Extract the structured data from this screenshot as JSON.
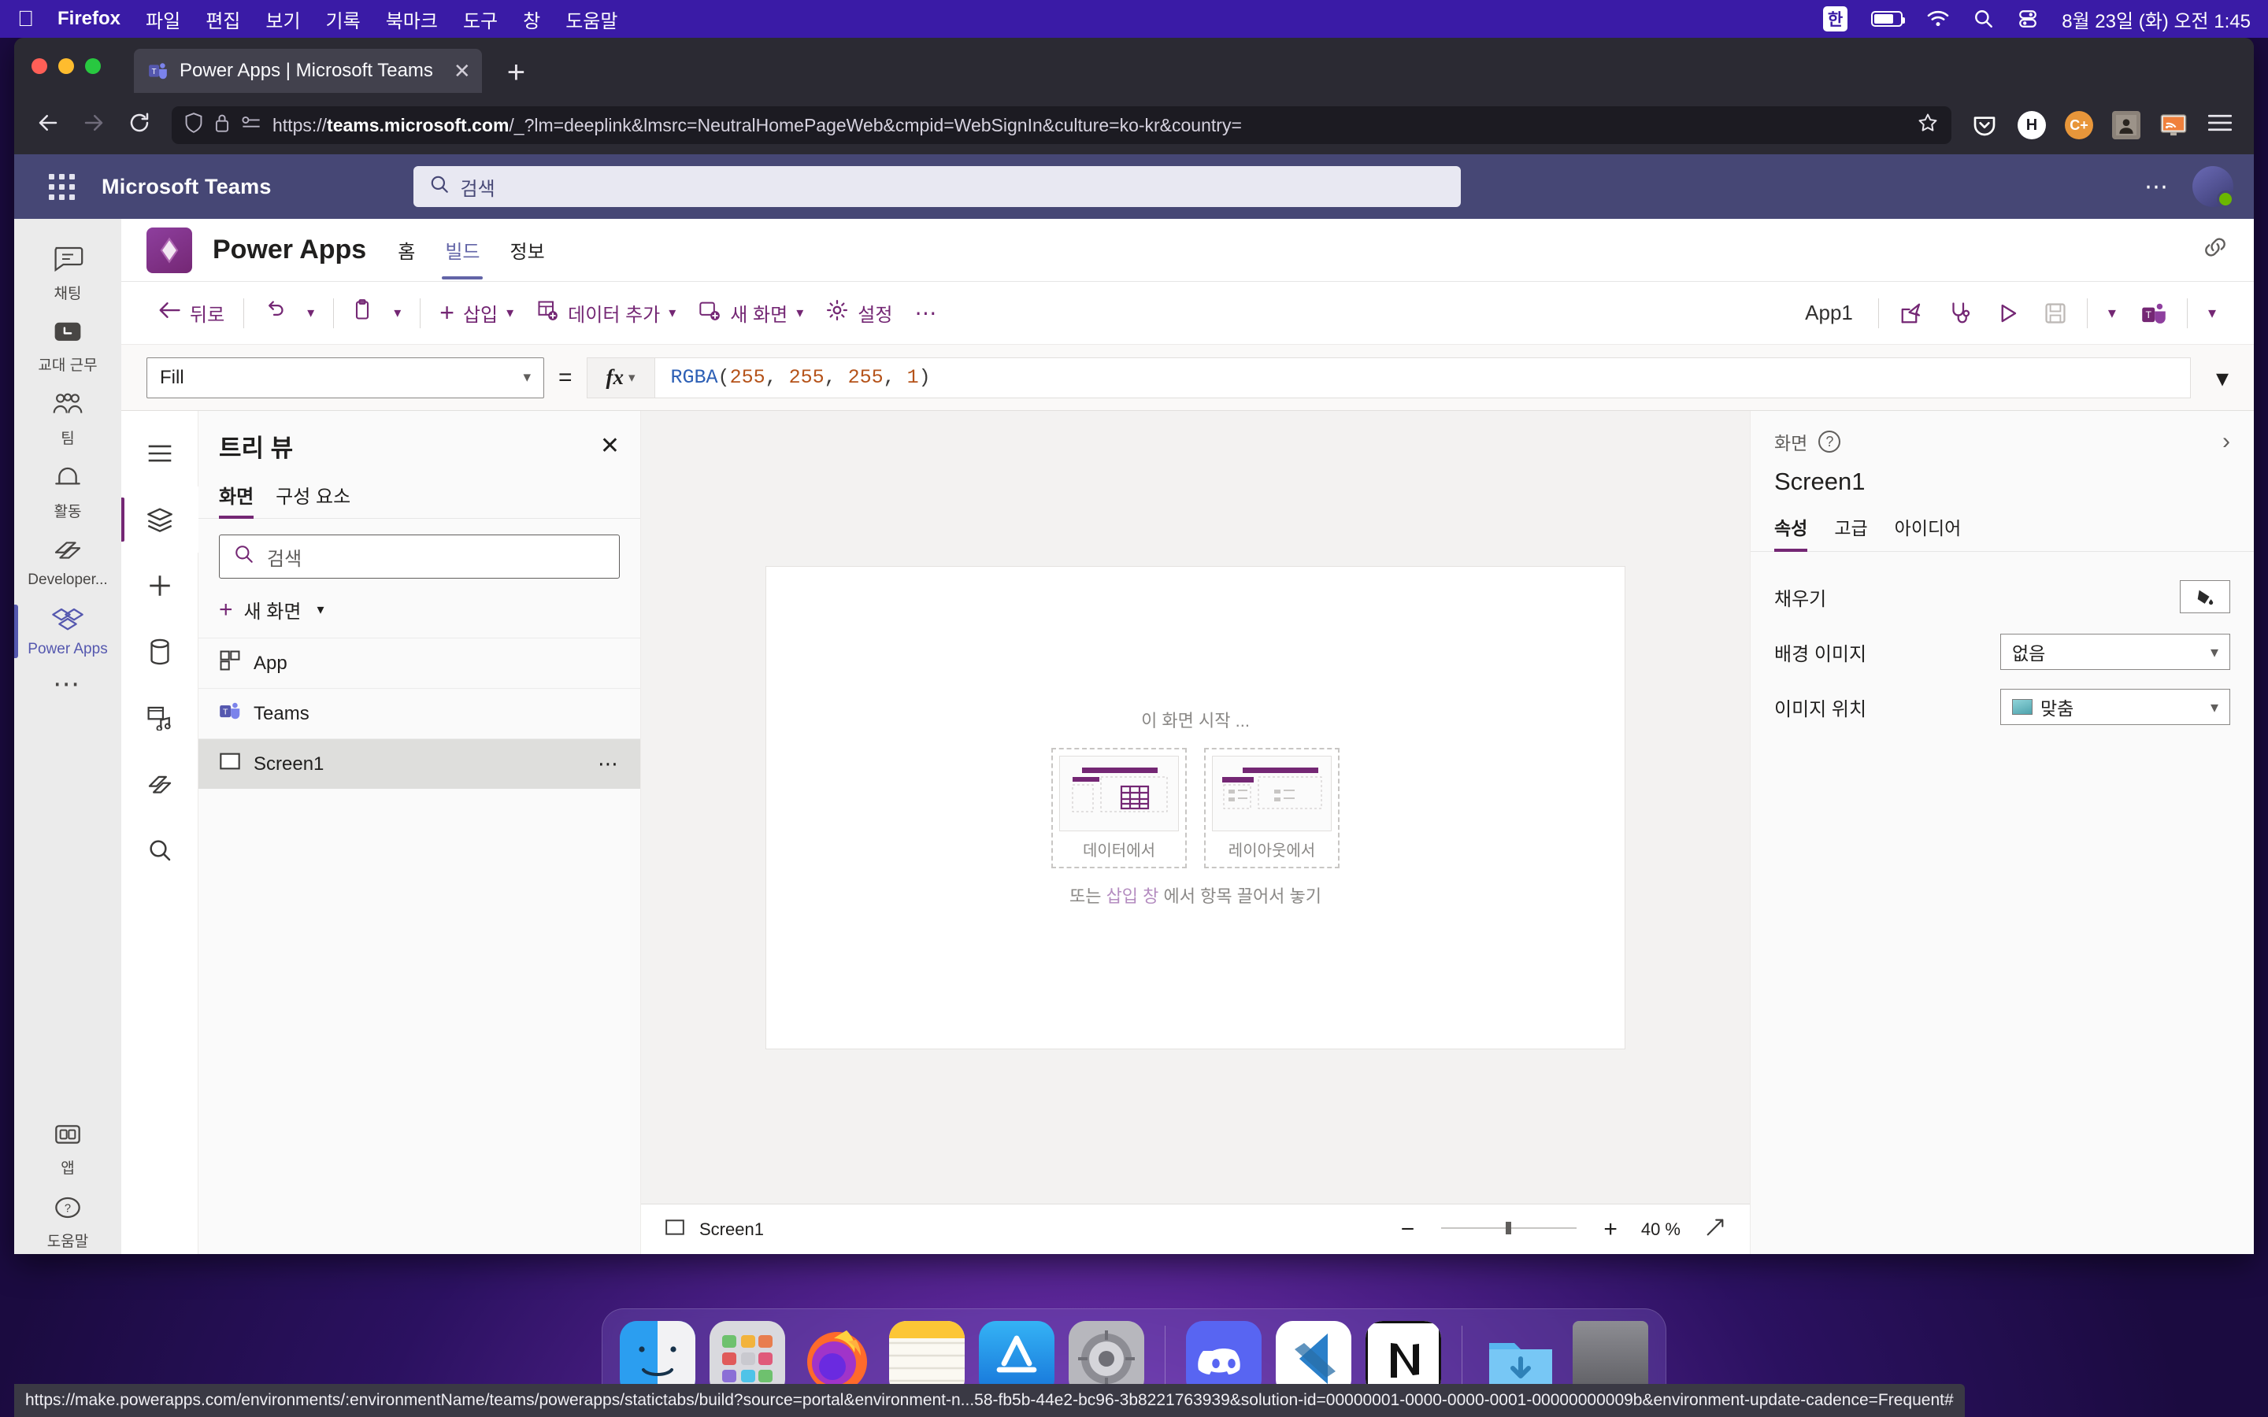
{
  "macos_menubar": {
    "apple_icon": "apple-icon",
    "app_name": "Firefox",
    "menus": [
      "파일",
      "편집",
      "보기",
      "기록",
      "북마크",
      "도구",
      "창",
      "도움말"
    ],
    "input_source": "한",
    "status_icons": [
      "battery-icon",
      "wifi-icon",
      "search-icon",
      "control-center-icon"
    ],
    "datetime": "8월 23일 (화) 오전 1:45"
  },
  "browser": {
    "tab": {
      "title": "Power Apps | Microsoft Teams",
      "favicon": "teams-icon",
      "close_icon": "close-icon"
    },
    "new_tab_icon": "plus-icon",
    "back_icon": "back-arrow-icon",
    "forward_icon": "forward-arrow-icon",
    "reload_icon": "reload-icon",
    "shield_icon": "shield-icon",
    "lock_icon": "lock-icon",
    "permissions_icon": "permissions-icon",
    "url": "https://teams.microsoft.com/_?lm=deeplink&lmsrc=NeutralHomePageWeb&cmpid=WebSignIn&culture=ko-kr&country=",
    "url_host": "teams.microsoft.com",
    "url_scheme": "https://",
    "url_rest": "/_?lm=deeplink&lmsrc=NeutralHomePageWeb&cmpid=WebSignIn&culture=ko-kr&country=",
    "bookmark_icon": "star-icon",
    "extensions": [
      "pocket-icon",
      "h-extension-icon",
      "c-plus-extension-icon",
      "dark-extension-icon",
      "rss-extension-icon"
    ],
    "menu_icon": "hamburger-menu-icon"
  },
  "teams": {
    "waffle_icon": "app-launcher-icon",
    "title": "Microsoft Teams",
    "search": {
      "placeholder": "검색",
      "icon": "search-icon"
    },
    "more_icon": "more-icon",
    "avatar": "user-avatar",
    "rail": [
      {
        "label": "채팅",
        "icon": "chat-icon",
        "active": false
      },
      {
        "label": "교대 근무",
        "icon": "shifts-icon",
        "active": false
      },
      {
        "label": "팀",
        "icon": "teams-people-icon",
        "active": false
      },
      {
        "label": "활동",
        "icon": "bell-icon",
        "active": false
      },
      {
        "label": "Developer...",
        "icon": "developer-portal-icon",
        "active": false
      },
      {
        "label": "Power Apps",
        "icon": "power-apps-icon",
        "active": true
      },
      {
        "label": "",
        "icon": "more-dots-icon",
        "active": false
      }
    ],
    "rail_bottom": [
      {
        "label": "앱",
        "icon": "apps-grid-icon"
      },
      {
        "label": "도움말",
        "icon": "help-icon"
      }
    ]
  },
  "powerapps": {
    "logo_icon": "power-apps-logo",
    "name": "Power Apps",
    "tabs": [
      {
        "label": "홈",
        "active": false
      },
      {
        "label": "빌드",
        "active": true
      },
      {
        "label": "정보",
        "active": false
      }
    ],
    "header_right_icon": "link-icon",
    "commandbar": {
      "back": {
        "label": "뒤로",
        "icon": "back-arrow-icon"
      },
      "undo_icon": "undo-icon",
      "undo_chevron": "chevron-down-icon",
      "paste_icon": "clipboard-icon",
      "paste_chevron": "chevron-down-icon",
      "insert": {
        "label": "삽입",
        "icon": "plus-icon",
        "chevron": "chevron-down-icon"
      },
      "add_data": {
        "label": "데이터 추가",
        "icon": "add-data-icon",
        "chevron": "chevron-down-icon"
      },
      "new_screen": {
        "label": "새 화면",
        "icon": "new-screen-icon",
        "chevron": "chevron-down-icon"
      },
      "settings": {
        "label": "설정",
        "icon": "gear-icon"
      },
      "overflow_icon": "more-icon",
      "app_name": "App1",
      "share_icon": "share-icon",
      "checker_icon": "app-checker-icon",
      "preview_icon": "play-icon",
      "save_icon": "save-icon",
      "save_chevron": "chevron-down-icon",
      "teams_icon": "teams-icon",
      "teams_chevron": "chevron-down-icon"
    },
    "formula_bar": {
      "property": "Fill",
      "property_chevron": "chevron-down-icon",
      "equals": "=",
      "fx_icon": "fx-icon",
      "fx_chevron": "chevron-down-icon",
      "formula_fn": "RGBA",
      "formula_open": "(",
      "formula_args": [
        "255",
        "255",
        "255",
        "1"
      ],
      "formula_close": ")",
      "formula_full": "RGBA(255, 255, 255, 1)",
      "collapse_icon": "chevron-down-icon"
    },
    "mini_rail": [
      {
        "icon": "hamburger-menu-icon",
        "active": false
      },
      {
        "icon": "tree-view-layers-icon",
        "active": true
      },
      {
        "icon": "insert-plus-icon",
        "active": false
      },
      {
        "icon": "data-cylinder-icon",
        "active": false
      },
      {
        "icon": "media-icon",
        "active": false
      },
      {
        "icon": "power-automate-icon",
        "active": false
      },
      {
        "icon": "search-icon",
        "active": false
      }
    ],
    "treeview": {
      "title": "트리 뷰",
      "close_icon": "close-icon",
      "tabs": [
        {
          "label": "화면",
          "active": true
        },
        {
          "label": "구성 요소",
          "active": false
        }
      ],
      "search_placeholder": "검색",
      "search_icon": "search-icon",
      "new_screen": {
        "label": "새 화면",
        "plus": "+",
        "chevron": "chevron-down-icon"
      },
      "items": [
        {
          "label": "App",
          "icon": "app-node-icon",
          "selected": false,
          "has_menu": false
        },
        {
          "label": "Teams",
          "icon": "teams-icon",
          "selected": false,
          "has_menu": false
        },
        {
          "label": "Screen1",
          "icon": "screen-rect-icon",
          "selected": true,
          "has_menu": true,
          "menu_icon": "more-icon"
        }
      ]
    },
    "canvas": {
      "starter_hint": "이 화면 시작 ...",
      "options": [
        {
          "label": "데이터에서",
          "icon": "from-data-icon"
        },
        {
          "label": "레이아웃에서",
          "icon": "from-layout-icon"
        }
      ],
      "drag_hint_prefix": "또는 ",
      "drag_hint_link": "삽입 창",
      "drag_hint_suffix": " 에서 항목 끌어서 놓기",
      "footer": {
        "screen_label": "Screen1",
        "screen_icon": "screen-rect-icon",
        "zoom": "40 %",
        "minus_icon": "minus-icon",
        "plus_icon": "plus-icon",
        "fit_icon": "fit-screen-icon"
      }
    },
    "properties": {
      "type_label": "화면",
      "help_icon": "help-icon",
      "collapse_icon": "chevron-right-icon",
      "selected_name": "Screen1",
      "tabs": [
        {
          "label": "속성",
          "active": true
        },
        {
          "label": "고급",
          "active": false
        },
        {
          "label": "아이디어",
          "active": false
        }
      ],
      "rows": [
        {
          "label": "채우기",
          "control": "color-swatch",
          "value": "",
          "icon": "fill-bucket-icon"
        },
        {
          "label": "배경 이미지",
          "control": "dropdown",
          "value": "없음",
          "icon": ""
        },
        {
          "label": "이미지 위치",
          "control": "dropdown",
          "value": "맞춤",
          "icon": "image-icon"
        }
      ]
    }
  },
  "status_link": "https://make.powerapps.com/environments/:environmentName/teams/powerapps/statictabs/build?source=portal&environment-n...58-fb5b-44e2-bc96-3b8221763939&solution-id=00000001-0000-0000-0001-00000000009b&environment-update-cadence=Frequent#",
  "dock": {
    "items": [
      {
        "name": "finder",
        "label": "Finder",
        "running": true
      },
      {
        "name": "launchpad",
        "label": "Launchpad",
        "running": false
      },
      {
        "name": "firefox",
        "label": "Firefox",
        "running": true
      },
      {
        "name": "notes",
        "label": "Notes",
        "running": true
      },
      {
        "name": "app-store",
        "label": "App Store",
        "running": false
      },
      {
        "name": "system-preferences",
        "label": "System Preferences",
        "running": false
      },
      {
        "name": "discord",
        "label": "Discord",
        "running": true
      },
      {
        "name": "vscode",
        "label": "Visual Studio Code",
        "running": true
      },
      {
        "name": "notion",
        "label": "Notion",
        "running": false
      },
      {
        "name": "downloads",
        "label": "Downloads",
        "running": false
      },
      {
        "name": "trash",
        "label": "Trash",
        "running": false
      }
    ]
  },
  "colors": {
    "teams_purple": "#464775",
    "powerapps_purple": "#742774",
    "accent": "#6264a7",
    "menubar": "#3a1ba6"
  }
}
